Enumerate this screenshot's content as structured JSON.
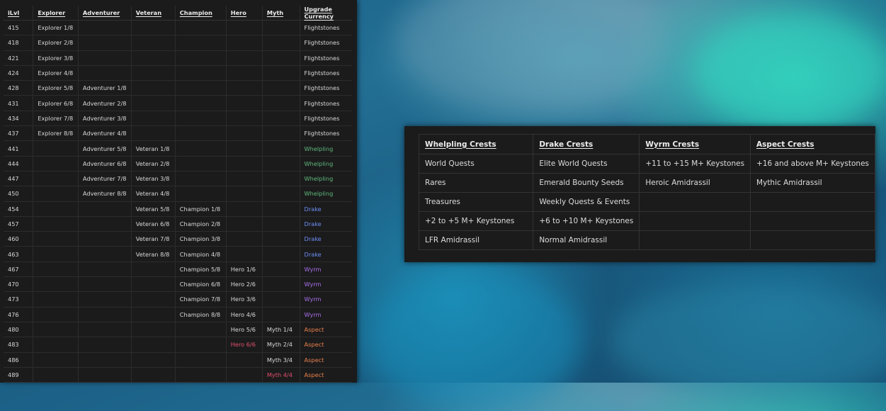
{
  "ilvl_table": {
    "headers": [
      "iLvl",
      "Explorer",
      "Adventurer",
      "Veteran",
      "Champion",
      "Hero",
      "Myth",
      "Upgrade Currency"
    ],
    "rows": [
      {
        "ilvl": "415",
        "explorer": "Explorer 1/8",
        "adventurer": "",
        "veteran": "",
        "champion": "",
        "hero": "",
        "myth": "",
        "currency": "Flightstones",
        "ctype": "flight"
      },
      {
        "ilvl": "418",
        "explorer": "Explorer 2/8",
        "adventurer": "",
        "veteran": "",
        "champion": "",
        "hero": "",
        "myth": "",
        "currency": "Flightstones",
        "ctype": "flight"
      },
      {
        "ilvl": "421",
        "explorer": "Explorer 3/8",
        "adventurer": "",
        "veteran": "",
        "champion": "",
        "hero": "",
        "myth": "",
        "currency": "Flightstones",
        "ctype": "flight"
      },
      {
        "ilvl": "424",
        "explorer": "Explorer 4/8",
        "adventurer": "",
        "veteran": "",
        "champion": "",
        "hero": "",
        "myth": "",
        "currency": "Flightstones",
        "ctype": "flight"
      },
      {
        "ilvl": "428",
        "explorer": "Explorer 5/8",
        "adventurer": "Adventurer 1/8",
        "veteran": "",
        "champion": "",
        "hero": "",
        "myth": "",
        "currency": "Flightstones",
        "ctype": "flight"
      },
      {
        "ilvl": "431",
        "explorer": "Explorer 6/8",
        "adventurer": "Adventurer 2/8",
        "veteran": "",
        "champion": "",
        "hero": "",
        "myth": "",
        "currency": "Flightstones",
        "ctype": "flight"
      },
      {
        "ilvl": "434",
        "explorer": "Explorer 7/8",
        "adventurer": "Adventurer 3/8",
        "veteran": "",
        "champion": "",
        "hero": "",
        "myth": "",
        "currency": "Flightstones",
        "ctype": "flight"
      },
      {
        "ilvl": "437",
        "explorer": "Explorer 8/8",
        "adventurer": "Adventurer 4/8",
        "veteran": "",
        "champion": "",
        "hero": "",
        "myth": "",
        "currency": "Flightstones",
        "ctype": "flight"
      },
      {
        "ilvl": "441",
        "explorer": "",
        "adventurer": "Adventurer 5/8",
        "veteran": "Veteran 1/8",
        "champion": "",
        "hero": "",
        "myth": "",
        "currency": "Whelpling",
        "ctype": "whelp"
      },
      {
        "ilvl": "444",
        "explorer": "",
        "adventurer": "Adventurer 6/8",
        "veteran": "Veteran 2/8",
        "champion": "",
        "hero": "",
        "myth": "",
        "currency": "Whelpling",
        "ctype": "whelp"
      },
      {
        "ilvl": "447",
        "explorer": "",
        "adventurer": "Adventurer 7/8",
        "veteran": "Veteran 3/8",
        "champion": "",
        "hero": "",
        "myth": "",
        "currency": "Whelpling",
        "ctype": "whelp"
      },
      {
        "ilvl": "450",
        "explorer": "",
        "adventurer": "Adventurer 8/8",
        "veteran": "Veteran 4/8",
        "champion": "",
        "hero": "",
        "myth": "",
        "currency": "Whelpling",
        "ctype": "whelp"
      },
      {
        "ilvl": "454",
        "explorer": "",
        "adventurer": "",
        "veteran": "Veteran 5/8",
        "champion": "Champion 1/8",
        "hero": "",
        "myth": "",
        "currency": "Drake",
        "ctype": "drake"
      },
      {
        "ilvl": "457",
        "explorer": "",
        "adventurer": "",
        "veteran": "Veteran 6/8",
        "champion": "Champion 2/8",
        "hero": "",
        "myth": "",
        "currency": "Drake",
        "ctype": "drake"
      },
      {
        "ilvl": "460",
        "explorer": "",
        "adventurer": "",
        "veteran": "Veteran 7/8",
        "champion": "Champion 3/8",
        "hero": "",
        "myth": "",
        "currency": "Drake",
        "ctype": "drake"
      },
      {
        "ilvl": "463",
        "explorer": "",
        "adventurer": "",
        "veteran": "Veteran 8/8",
        "champion": "Champion 4/8",
        "hero": "",
        "myth": "",
        "currency": "Drake",
        "ctype": "drake"
      },
      {
        "ilvl": "467",
        "explorer": "",
        "adventurer": "",
        "veteran": "",
        "champion": "Champion 5/8",
        "hero": "Hero 1/6",
        "myth": "",
        "currency": "Wyrm",
        "ctype": "wyrm"
      },
      {
        "ilvl": "470",
        "explorer": "",
        "adventurer": "",
        "veteran": "",
        "champion": "Champion 6/8",
        "hero": "Hero 2/6",
        "myth": "",
        "currency": "Wyrm",
        "ctype": "wyrm"
      },
      {
        "ilvl": "473",
        "explorer": "",
        "adventurer": "",
        "veteran": "",
        "champion": "Champion 7/8",
        "hero": "Hero 3/6",
        "myth": "",
        "currency": "Wyrm",
        "ctype": "wyrm"
      },
      {
        "ilvl": "476",
        "explorer": "",
        "adventurer": "",
        "veteran": "",
        "champion": "Champion 8/8",
        "hero": "Hero 4/6",
        "myth": "",
        "currency": "Wyrm",
        "ctype": "wyrm"
      },
      {
        "ilvl": "480",
        "explorer": "",
        "adventurer": "",
        "veteran": "",
        "champion": "",
        "hero": "Hero 5/6",
        "myth": "Myth 1/4",
        "currency": "Aspect",
        "ctype": "aspect"
      },
      {
        "ilvl": "483",
        "explorer": "",
        "adventurer": "",
        "veteran": "",
        "champion": "",
        "hero": "Hero 6/6",
        "myth": "Myth 2/4",
        "currency": "Aspect",
        "ctype": "aspect",
        "hero_highlight": true
      },
      {
        "ilvl": "486",
        "explorer": "",
        "adventurer": "",
        "veteran": "",
        "champion": "",
        "hero": "",
        "myth": "Myth 3/4",
        "currency": "Aspect",
        "ctype": "aspect"
      },
      {
        "ilvl": "489",
        "explorer": "",
        "adventurer": "",
        "veteran": "",
        "champion": "",
        "hero": "",
        "myth": "Myth 4/4",
        "currency": "Aspect",
        "ctype": "aspect",
        "myth_highlight": true
      }
    ]
  },
  "crest_table": {
    "headers": [
      "Whelpling Crests",
      "Drake Crests",
      "Wyrm Crests",
      "Aspect Crests"
    ],
    "rows": [
      [
        "World Quests",
        "Elite World Quests",
        "+11 to +15 M+ Keystones",
        "+16 and above M+ Keystones"
      ],
      [
        "Rares",
        "Emerald Bounty Seeds",
        "Heroic Amidrassil",
        "Mythic Amidrassil"
      ],
      [
        "Treasures",
        "Weekly Quests & Events",
        "",
        ""
      ],
      [
        "+2 to +5 M+ Keystones",
        "+6 to +10 M+ Keystones",
        "",
        ""
      ],
      [
        "LFR Amidrassil",
        "Normal Amidrassil",
        "",
        ""
      ]
    ]
  },
  "colors": {
    "whelpling": "#5fb87a",
    "drake": "#6d8df0",
    "wyrm": "#a870e8",
    "aspect": "#e8804a",
    "highlight": "#e0506a"
  }
}
